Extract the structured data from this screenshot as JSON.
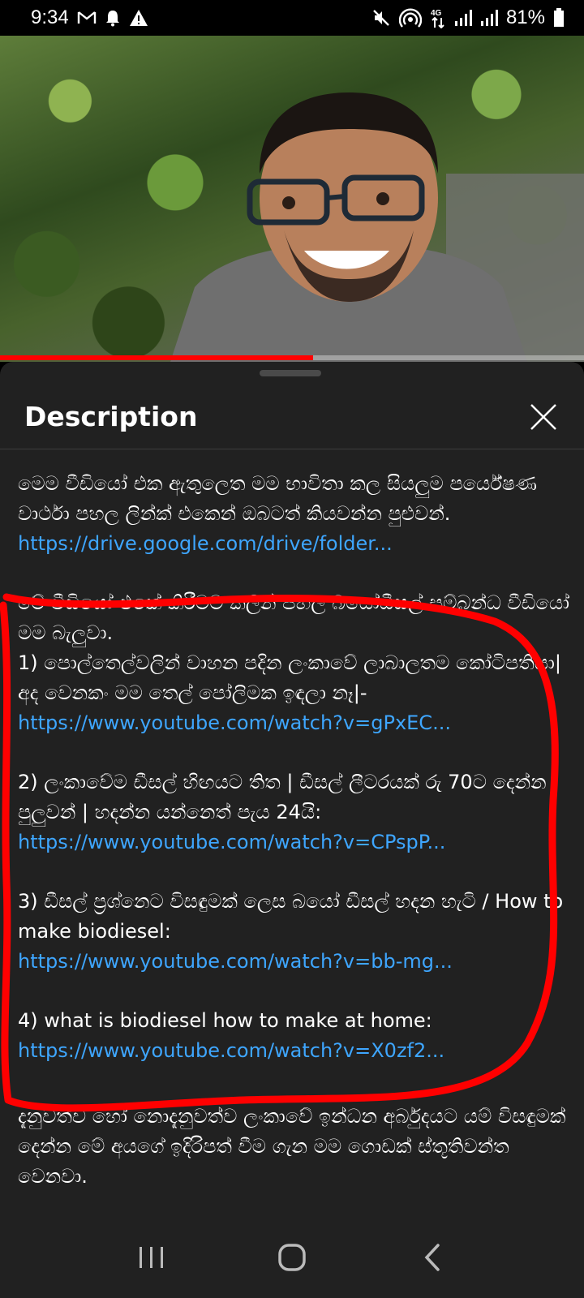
{
  "status_bar": {
    "time": "9:34",
    "left_icons": [
      "gmail-icon",
      "bell-icon",
      "alert-icon"
    ],
    "right_icons": [
      "mute-icon",
      "hotspot-icon",
      "network-4g-icon",
      "signal-icon",
      "signal-icon"
    ],
    "battery": "81%",
    "network_label": "4G"
  },
  "video": {
    "progress_fraction": 0.536,
    "progress_color": "#ff0000"
  },
  "sheet": {
    "title": "Description",
    "close_icon": "close-icon"
  },
  "description": {
    "intro": {
      "text": "මෙම වීඩියෝ එක ඇතුලෙත මම භාවිතා කල සියලුම පර්යේෂණ වාර්ථා පහල ලින්ක් එකෙන් ඔබටත් කියවන්න පුළුවන්.",
      "link": "https://drive.google.com/drive/folder..."
    },
    "related_intro": "මේ වීඩියෝ එකේ කිරීමට කලින් පහල බයෝඩීසල් සම්බන්ධ වීඩියෝ මම බැලුවා.",
    "items": [
      {
        "text": "1) පොල්තෙල්වලින් වාහන පදින ලංකාවේ ලාබාලතම කෝටිපතියා|අද වෙනකං මම තෙල් පෝලිමක ඉඳලා නෑ|-",
        "link": "https://www.youtube.com/watch?v=gPxEC..."
      },
      {
        "text": "2) ලංකාවේම ඩීසල් හිඟයට තිත | ඩීසල් ලීටරයක් රු 70ට දෙන්න පුලුවන් | හදන්න යන්නෙත් පැය 24යි:",
        "link": "https://www.youtube.com/watch?v=CPspP..."
      },
      {
        "text": "3) ඩීසල් ප්‍රශ්නෙට විසඳුමක් ලෙස බයෝ ඩීසල් හදන හැටි / How to make biodiesel:",
        "link": "https://www.youtube.com/watch?v=bb-mg..."
      },
      {
        "text": "4) what is biodiesel how to make at home:",
        "link": "https://www.youtube.com/watch?v=X0zf2..."
      }
    ],
    "outro": "දැනුවත්ව හෝ නොදැනුවත්ව ලංකාවේ ඉන්ධන අර්බුදයට යම් විසඳුමක් දෙන්න මේ අයගේ ඉදිරිපත් වීම ගැන මම ගොඩක් ස්තූතිවන්ත වෙනවා."
  },
  "annotation": {
    "color": "#ff0000"
  },
  "nav_bar": {
    "buttons": [
      "recents-icon",
      "home-icon",
      "back-icon"
    ]
  }
}
